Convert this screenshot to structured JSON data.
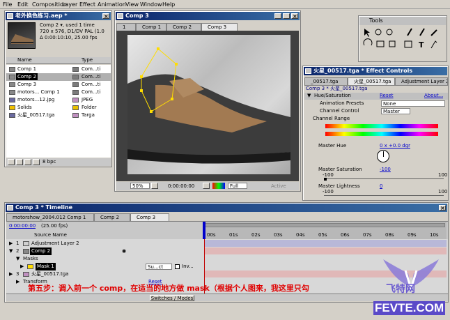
{
  "menubar": {
    "items": [
      "File",
      "Edit",
      "Composition",
      "Layer",
      "Effect",
      "Animation",
      "View",
      "Window",
      "Help"
    ]
  },
  "project": {
    "title": "老外换色练习.aep *",
    "info": [
      "Comp 2 ▾, used 1 time",
      "720 x 576, D1/DV PAL (1.0",
      "Δ 0:00:10:10, 25.00 fps"
    ],
    "col_name": "Name",
    "col_type": "Type",
    "items": [
      {
        "name": "Comp 1",
        "type": "Com...ti",
        "color": "#7c7c7c"
      },
      {
        "name": "Comp 2",
        "type": "Com...ti",
        "color": "#7c7c7c"
      },
      {
        "name": "Comp 3",
        "type": "Com...ti",
        "color": "#7c7c7c"
      },
      {
        "name": "motors... Comp 1",
        "type": "Com...ti",
        "color": "#7c7c7c"
      },
      {
        "name": "motors...12.jpg",
        "type": "JPEG",
        "color": "#c090c0"
      },
      {
        "name": "Solids",
        "type": "Folder",
        "color": "#e8c000"
      },
      {
        "name": "火星_00517.tga",
        "type": "Targa",
        "color": "#c090c0"
      }
    ],
    "bpc": "8 bpc"
  },
  "comp_viewer": {
    "title": "Comp 3",
    "tabs": [
      "1",
      "Comp 1",
      "Comp 2",
      "Comp 3"
    ],
    "zoom": "50%",
    "time": "0:00:00:00",
    "resolution": "Full",
    "active": "Active"
  },
  "tools": {
    "title": "Tools"
  },
  "effect_controls": {
    "title": "火星_00517.tga * Effect Controls",
    "tabs": [
      "_00517.tga",
      "火星_00517.tga",
      "Adjustment Layer 2"
    ],
    "path": "Comp 3 * 火星_00517.tga",
    "effect_name": "Hue/Saturation",
    "reset": "Reset",
    "about": "About...",
    "anim_presets_label": "Animation Presets",
    "anim_presets_value": "None",
    "channel_control_label": "Channel Control",
    "channel_control_value": "Master",
    "channel_range_label": "Channel Range",
    "master_hue_label": "Master Hue",
    "master_hue_value": "0 x +0.0 dgr",
    "master_sat_label": "Master Saturation",
    "master_sat_value": "-100",
    "range_min": "-100",
    "range_max": "100",
    "master_light_label": "Master Lightness",
    "master_light_value": "0",
    "light_min": "-100",
    "light_max": "100"
  },
  "timeline": {
    "title": "Comp 3 * Timeline",
    "tabs": [
      "motorshow_2004.012 Comp 1",
      "Comp 2",
      "Comp 3"
    ],
    "time": "0:00:00:00",
    "fps": "(25.00 fps)",
    "col_source": "Source Name",
    "layers": [
      {
        "num": "1",
        "name": "Adjustment Layer 2"
      },
      {
        "num": "2",
        "name": "Comp 2"
      },
      {
        "num": "3",
        "name": "火星_00517.tga"
      }
    ],
    "masks_label": "Masks",
    "mask_name": "Mask 1",
    "mask_mode": "Su...ct",
    "mask_inv": "Inv...",
    "transform_label": "Transform",
    "transform_reset": "Reset",
    "ruler": [
      "00s",
      "01s",
      "02s",
      "03s",
      "04s",
      "05s",
      "06s",
      "07s",
      "08s",
      "09s",
      "10s"
    ],
    "switches": "Switches / Modes"
  },
  "caption": "第五步：调入前一个 comp，在适当的地方做 mask（根据个人图来，我这里只勾",
  "watermark": {
    "brand": "飞特网",
    "url": "FEVTE.COM"
  }
}
